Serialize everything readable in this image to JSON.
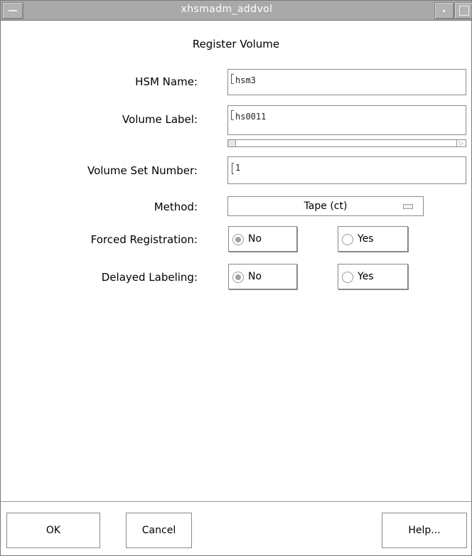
{
  "window": {
    "title": "xhsmadm_addvol"
  },
  "heading": "Register Volume",
  "fields": {
    "hsm_name": {
      "label": "HSM Name:",
      "value": "hsm3"
    },
    "volume_label": {
      "label": "Volume Label:",
      "value": "hs0011"
    },
    "volume_set_number": {
      "label": "Volume Set Number:",
      "value": "1"
    },
    "method": {
      "label": "Method:",
      "value": "Tape (ct)"
    }
  },
  "forced_registration": {
    "label": "Forced Registration:",
    "options": [
      {
        "label": "No",
        "selected": true
      },
      {
        "label": "Yes",
        "selected": false
      }
    ]
  },
  "delayed_labeling": {
    "label": "Delayed Labeling:",
    "options": [
      {
        "label": "No",
        "selected": true
      },
      {
        "label": "Yes",
        "selected": false
      }
    ]
  },
  "buttons": {
    "ok": "OK",
    "cancel": "Cancel",
    "help": "Help..."
  },
  "colors": {
    "titlebar": "#a9a9a9",
    "radio_selected": "#a0a0a0",
    "border": "#8a8a8a"
  }
}
